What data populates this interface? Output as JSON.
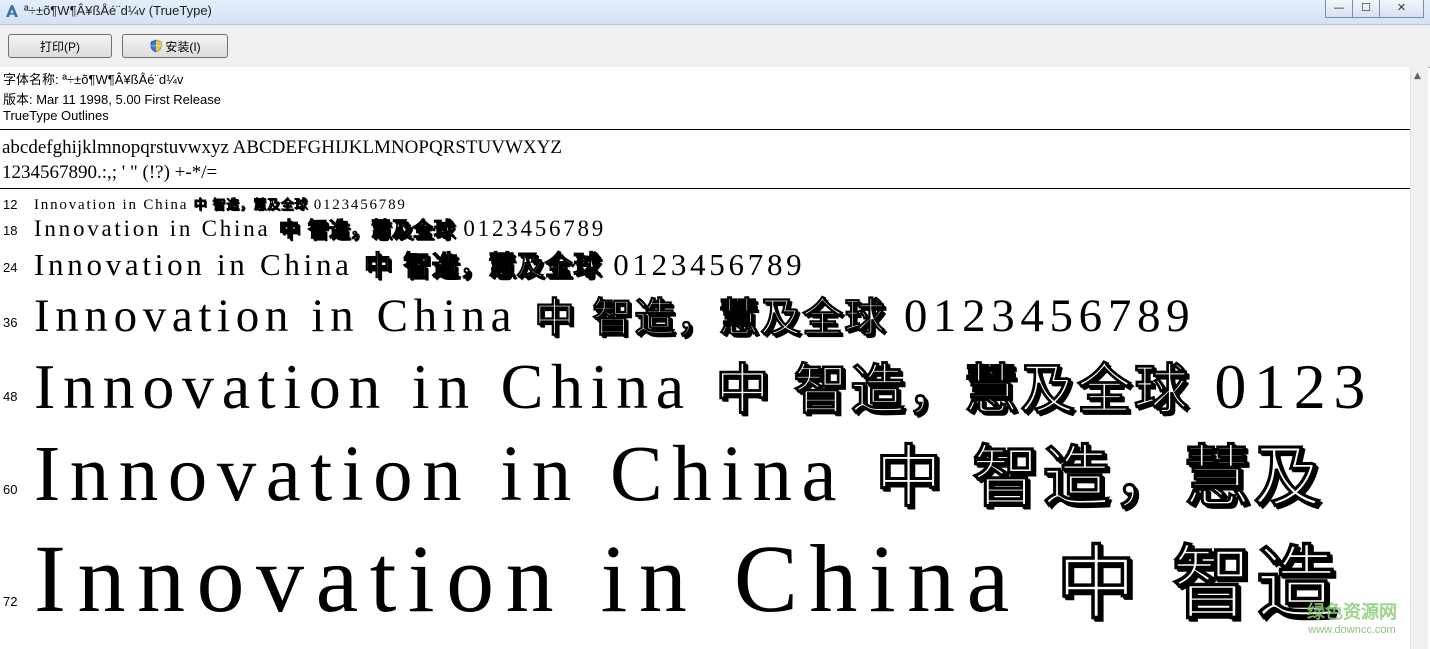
{
  "window": {
    "title": "ª÷±õ¶W¶Â¥ßÅé¨d¼v (TrueType)",
    "minimize_glyph": "—",
    "maximize_glyph": "☐",
    "close_glyph": "✕"
  },
  "toolbar": {
    "print_label": "打印(P)",
    "install_label": "安装(I)"
  },
  "info": {
    "font_name": "字体名称: ª÷±õ¶W¶Â¥ßÅé¨d¼v",
    "version": "版本: Mar 11 1998, 5.00 First Release",
    "outline_type": "TrueType Outlines"
  },
  "charset": {
    "line1": "abcdefghijklmnopqrstuvwxyz ABCDEFGHIJKLMNOPQRSTUVWXYZ",
    "line2": "1234567890.:,; ' \" (!?) +-*/="
  },
  "samples": [
    {
      "size": "12",
      "latin": "Innovation in China",
      "cjk": "中  智造，慧及全球",
      "digits": "0123456789"
    },
    {
      "size": "18",
      "latin": "Innovation in China",
      "cjk": "中  智造，慧及全球",
      "digits": "0123456789"
    },
    {
      "size": "24",
      "latin": "Innovation in China",
      "cjk": "中  智造，慧及全球",
      "digits": "0123456789"
    },
    {
      "size": "36",
      "latin": "Innovation in China",
      "cjk": "中  智造，慧及全球",
      "digits": "0123456789"
    },
    {
      "size": "48",
      "latin": "Innovation in China",
      "cjk": "中  智造，慧及全球",
      "digits": "0123"
    },
    {
      "size": "60",
      "latin": "Innovation in China",
      "cjk": "中  智造，慧及",
      "digits": ""
    },
    {
      "size": "72",
      "latin": "Innovation in China",
      "cjk": "中  智造",
      "digits": ""
    }
  ],
  "watermark": {
    "main": "绿色资源网",
    "sub": "www.downcc.com"
  },
  "colors": {
    "title_bar": "#d3e2f4",
    "toolbar": "#f0f0f0",
    "watermark": "#8dcc7a"
  }
}
